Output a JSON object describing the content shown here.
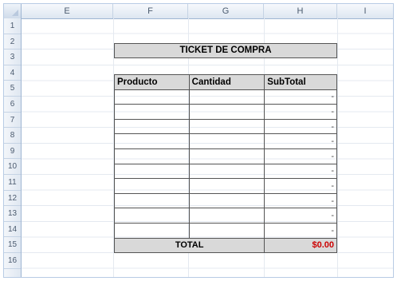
{
  "columns": [
    "E",
    "F",
    "G",
    "H",
    "I"
  ],
  "rows": [
    "1",
    "2",
    "3",
    "4",
    "5",
    "6",
    "7",
    "8",
    "9",
    "10",
    "11",
    "12",
    "13",
    "14",
    "15",
    "16"
  ],
  "ticket": {
    "title": "TICKET DE COMPRA",
    "headers": [
      "Producto",
      "Cantidad",
      "SubTotal"
    ],
    "subtotals": [
      "-",
      "-",
      "-",
      "-",
      "-",
      "-",
      "-",
      "-",
      "-",
      "-"
    ],
    "total_label": "TOTAL",
    "total_value": "$0.00"
  },
  "colors": {
    "header_fill": "#d9d9d9",
    "total_value": "#cc0000",
    "sheet_header": "#dde6f1"
  }
}
